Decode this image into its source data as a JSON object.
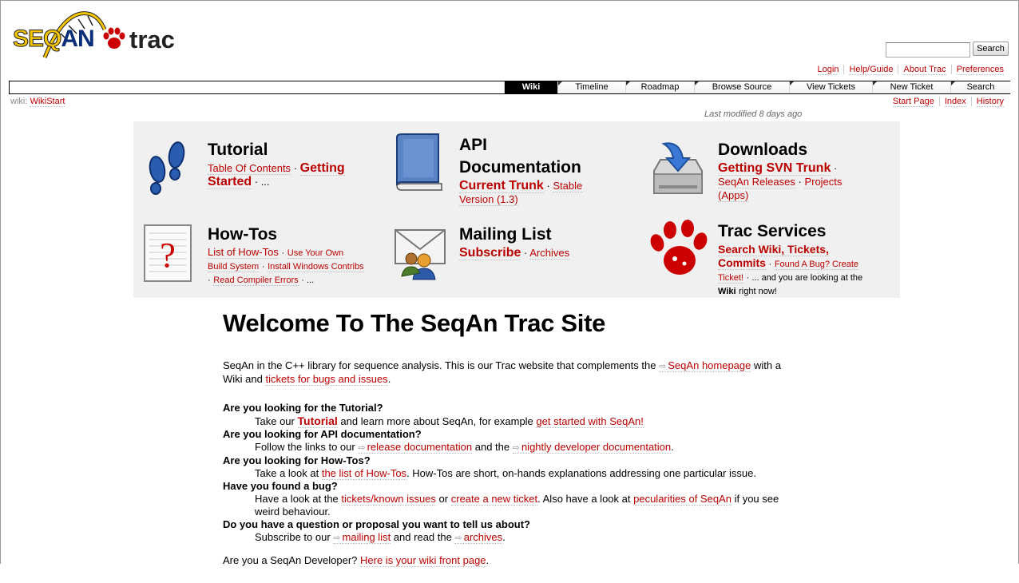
{
  "header": {
    "logo_seqan_a": "SEQ",
    "logo_seqan_b": "AN",
    "logo_trac": "trac",
    "search_placeholder": "",
    "search_button": "Search"
  },
  "metanav": [
    "Login",
    "Help/Guide",
    "About Trac",
    "Preferences"
  ],
  "mainnav": [
    "Wiki",
    "Timeline",
    "Roadmap",
    "Browse Source",
    "View Tickets",
    "New Ticket",
    "Search"
  ],
  "breadcrumb": {
    "prefix": "wiki:",
    "page": "WikiStart"
  },
  "ctxnav": [
    "Start Page",
    "Index",
    "History"
  ],
  "last_modified": "Last modified 8 days ago",
  "panel": {
    "tutorial": {
      "title": "Tutorial",
      "toc": "Table Of Contents",
      "sep": "·",
      "getting": "Getting",
      "started": "Started",
      "more": "· ..."
    },
    "api": {
      "title1": "API",
      "title2": "Documentation",
      "current": "Current Trunk",
      "sep": "·",
      "stable": "Stable",
      "version": "Version (1.3)"
    },
    "downloads": {
      "title": "Downloads",
      "svn": "Getting SVN Trunk",
      "sep": "·",
      "releases": "SeqAn Releases",
      "sep2": "·",
      "projects": "Projects",
      "apps": "(Apps)"
    },
    "howtos": {
      "title": "How-Tos",
      "list": "List of How-Tos",
      "sep": "·",
      "use1": "Use Your Own",
      "use2": "Build System",
      "sep2": "·",
      "install": "Install Windows Contribs",
      "sep3": "·",
      "read": "Read Compiler Errors",
      "more": "· ..."
    },
    "mailing": {
      "title": "Mailing List",
      "subscribe": "Subscribe",
      "sep": "·",
      "archives": "Archives"
    },
    "trac": {
      "title": "Trac Services",
      "search1": "Search Wiki, Tickets,",
      "search2": "Commits",
      "sep": "·",
      "bug1": "Found A Bug? Create",
      "bug2": "Ticket!",
      "rest": "· ... and you are looking at the",
      "wiki": "Wiki",
      "rest2": "right now!"
    }
  },
  "main": {
    "heading": "Welcome To The SeqAn Trac Site",
    "intro_1": "SeqAn in the C++ library for sequence analysis. This is our Trac website that complements the",
    "intro_link1a": "SeqAn",
    "intro_link1b": "homepage",
    "intro_2": "with a Wiki and",
    "intro_link2": "tickets for bugs and issues",
    "intro_3": ".",
    "q1": "Are you looking for the Tutorial?",
    "a1_1": "Take our",
    "a1_link1": "Tutorial",
    "a1_2": "and learn more about SeqAn, for example",
    "a1_link2": "get started with SeqAn!",
    "q2": "Are you looking for API documentation?",
    "a2_1": "Follow the links to our",
    "a2_link1": "release documentation",
    "a2_2": "and the",
    "a2_link2": "nightly developer documentation",
    "a2_3": ".",
    "q3": "Are you looking for How-Tos?",
    "a3_1": "Take a look at",
    "a3_link1": "the list of How-Tos",
    "a3_2": ". How-Tos are short, on-hands explanations addressing one particular issue.",
    "q4": "Have you found a bug?",
    "a4_1": "Have a look at the",
    "a4_link1": "tickets/known issues",
    "a4_2": "or",
    "a4_link2": "create a new ticket",
    "a4_3": ". Also have a look at",
    "a4_link3": "pecularities of SeqAn",
    "a4_4": "if you see weird behaviour.",
    "q5": "Do you have a question or proposal you want to tell us about?",
    "a5_1": "Subscribe to our",
    "a5_link1": "mailing list",
    "a5_2": "and read the",
    "a5_link2": "archives",
    "a5_3": ".",
    "dev_1": "Are you a SeqAn Developer?",
    "dev_link": "Here is your wiki front page",
    "dev_2": "."
  },
  "colors": {
    "link": "#bb0000",
    "nav_active": "#000000",
    "panel_bg": "#f0f0f0"
  }
}
